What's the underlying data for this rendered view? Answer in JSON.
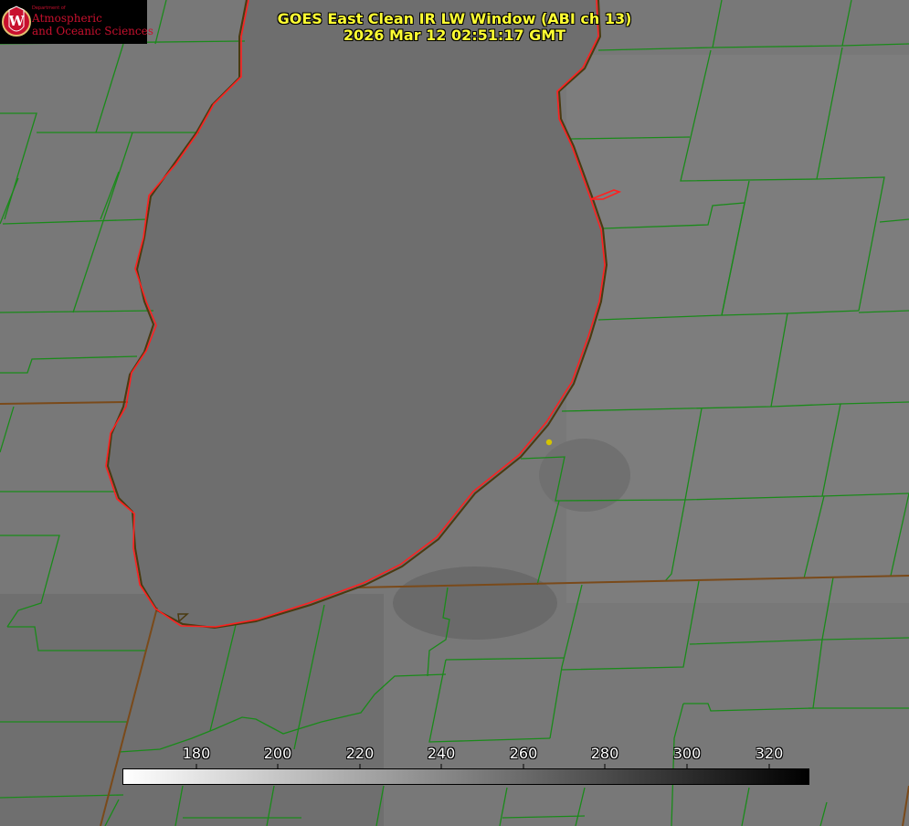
{
  "title": {
    "line1": "GOES East Clean IR LW Window (ABI ch 13)",
    "line2": "2026 Mar 12 02:51:17 GMT"
  },
  "logo": {
    "dept": "Department of",
    "line1": "Atmospheric",
    "line2": "and Oceanic Sciences",
    "initial": "W"
  },
  "colorbar": {
    "min": 162,
    "max": 330,
    "ticks": [
      "180",
      "200",
      "220",
      "240",
      "260",
      "280",
      "300",
      "320"
    ],
    "tick_values": [
      180,
      200,
      220,
      240,
      260,
      280,
      300,
      320
    ],
    "color_low": "#ffffff",
    "color_high": "#000000"
  },
  "colors": {
    "county_lines": "#1a8a1a",
    "coastline": "#ff2020",
    "title_text": "#ffff33",
    "lake": "#6e6e6e",
    "land": "#787878",
    "marker": "#d4c400"
  },
  "markers": [
    {
      "name": "city-dot-icon"
    }
  ]
}
